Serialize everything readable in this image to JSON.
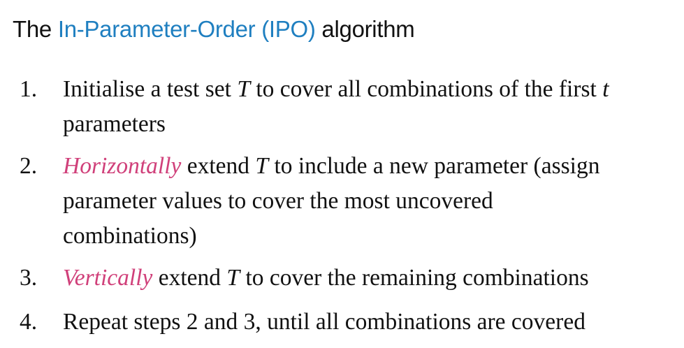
{
  "title": {
    "prefix": "The ",
    "accent": "In-Parameter-Order (IPO)",
    "suffix": " algorithm"
  },
  "steps": [
    {
      "number": "1.",
      "lines": [
        {
          "a": "Initialise a test set ",
          "b": "T",
          "c": " to cover all combinations of the first ",
          "d": "t"
        },
        {
          "a": "parameters"
        }
      ]
    },
    {
      "number": "2.",
      "lines": [
        {
          "em": "Horizontally",
          "a": " extend ",
          "b": "T",
          "c": " to include a new parameter (assign"
        },
        {
          "a": "parameter values to cover the most uncovered"
        },
        {
          "a": "combinations)"
        }
      ]
    },
    {
      "number": "3.",
      "lines": [
        {
          "em": "Vertically",
          "a": " extend ",
          "b": "T",
          "c": " to cover the remaining combinations"
        }
      ]
    },
    {
      "number": "4.",
      "lines": [
        {
          "a": "Repeat steps 2 and 3, until all combinations are covered"
        }
      ]
    }
  ],
  "colors": {
    "accent": "#1f7fc0",
    "emphasis": "#d0407a",
    "text": "#111111",
    "background": "#ffffff"
  }
}
